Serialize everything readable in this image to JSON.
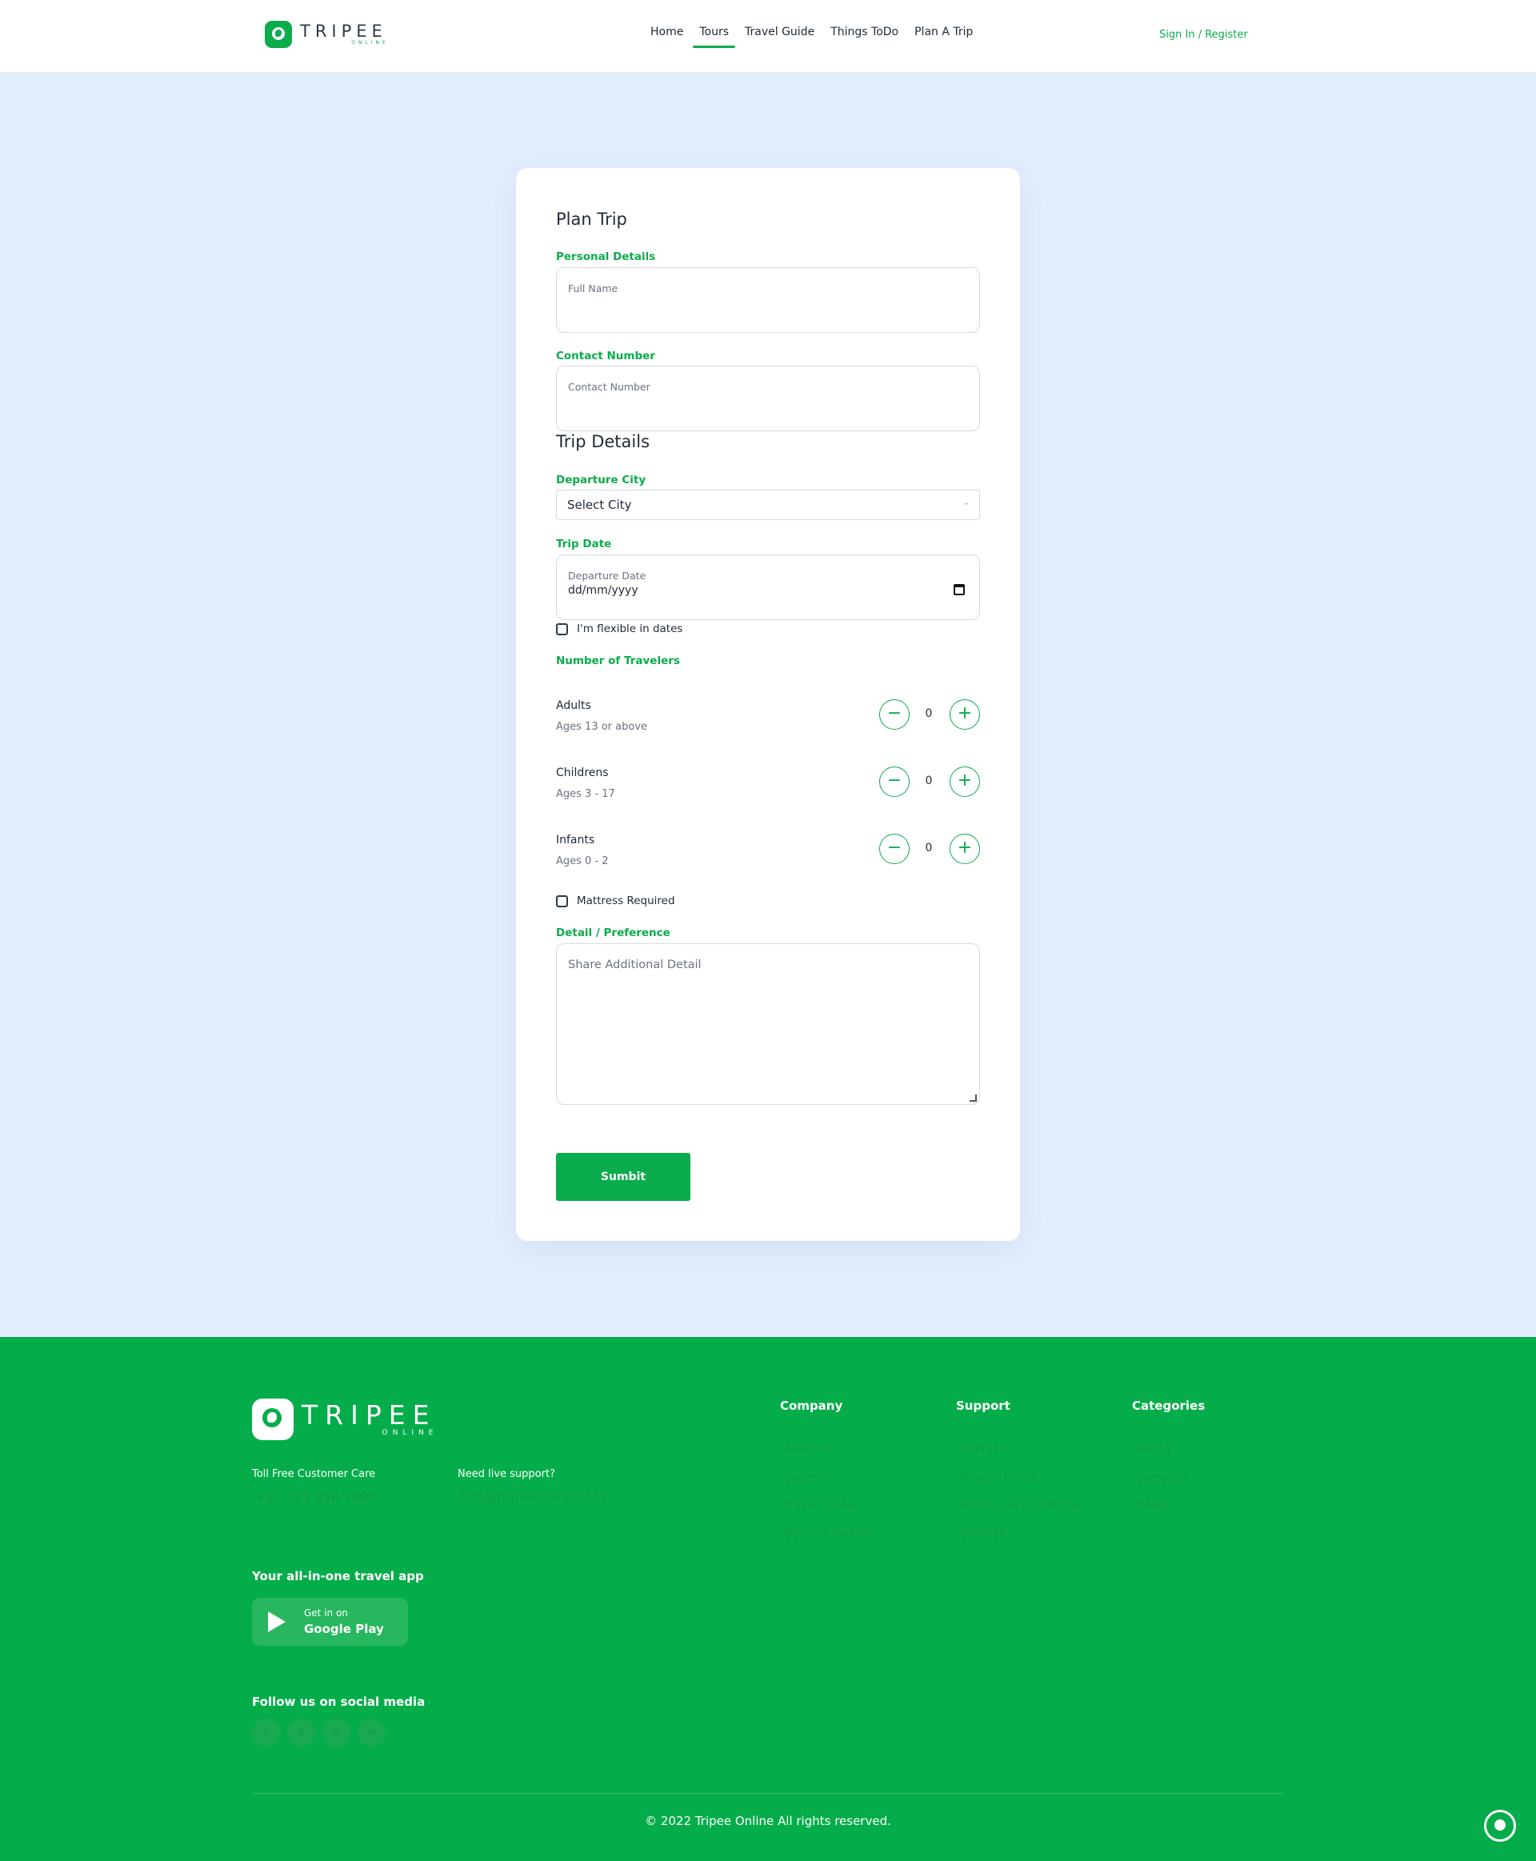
{
  "header": {
    "logo_word": "TRIPEE",
    "logo_sub": "ONLINE",
    "nav": [
      "Home",
      "Tours",
      "Travel Guide",
      "Things ToDo",
      "Plan A Trip"
    ],
    "active_nav": "Tours",
    "signin": "Sign In / Register"
  },
  "form": {
    "title": "Plan Trip",
    "personal_label": "Personal Details",
    "full_name_placeholder": "Full Name",
    "contact_label": "Contact Number",
    "contact_placeholder": "Contact Number",
    "trip_title": "Trip Details",
    "departure_label": "Departure City",
    "departure_value": "Select City",
    "trip_date_label": "Trip Date",
    "departure_date_placeholder": "Departure Date",
    "date_value": "dd/mm/yyyy",
    "flexible_label": "I'm flexible in dates",
    "travelers_label": "Number of Travelers",
    "travelers": [
      {
        "name": "Adults",
        "age": "Ages 13 or above",
        "count": "0"
      },
      {
        "name": "Childrens",
        "age": "Ages 3 - 17",
        "count": "0"
      },
      {
        "name": "Infants",
        "age": "Ages 0 - 2",
        "count": "0"
      }
    ],
    "mattress_label": "Mattress Required",
    "detail_label": "Detail / Preference",
    "detail_placeholder": "Share Additional Detail",
    "submit": "Sumbit"
  },
  "footer": {
    "logo_word": "TRIPEE",
    "logo_sub": "ONLINE",
    "toll_free_label": "Toll Free Customer Care",
    "toll_free_value": "+92 123 456 7890",
    "support_label": "Need live support?",
    "support_value": "info@tripeeonline.com",
    "app_heading": "Your all-in-one travel app",
    "gplay_line1": "Get in on",
    "gplay_line2": "Google Play",
    "social_heading": "Follow us on social media",
    "social_icons": [
      "facebook-icon",
      "twitter-icon",
      "instagram-icon",
      "linkedin-icon"
    ],
    "columns": [
      {
        "title": "Company",
        "links": [
          "About Us",
          "Careers",
          "Travel Guides",
          "Become Partner"
        ]
      },
      {
        "title": "Support",
        "links": [
          "Contact",
          "Privacy Policy",
          "Terms and Conditions",
          "Sitemap"
        ]
      },
      {
        "title": "Categories",
        "links": [
          "Hiking",
          "Camping",
          "Desert"
        ]
      }
    ],
    "copyright": "© 2022 Tripee Online All rights reserved."
  },
  "colors": {
    "brand": "#0bac4b",
    "footer_bg": "#05ad4a",
    "page_bg": "#e3eefc"
  }
}
